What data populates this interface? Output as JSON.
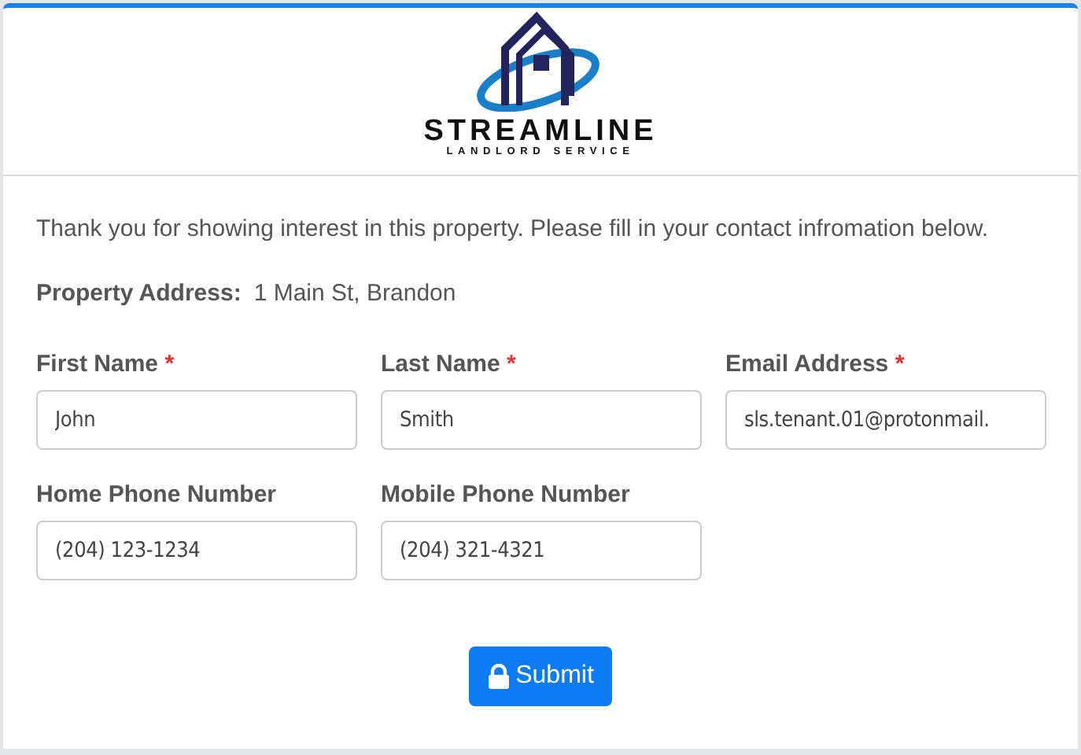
{
  "logo": {
    "name": "STREAMLINE",
    "tagline": "LANDLORD SERVICE"
  },
  "intro": "Thank you for showing interest in this property. Please fill in your contact infromation below.",
  "property_address": {
    "label": "Property Address:",
    "value": "1 Main St, Brandon"
  },
  "fields": [
    {
      "label": "First Name",
      "required": true,
      "value": "John"
    },
    {
      "label": "Last Name",
      "required": true,
      "value": "Smith"
    },
    {
      "label": "Email Address",
      "required": true,
      "value": "sls.tenant.01@protonmail."
    },
    {
      "label": "Home Phone Number",
      "required": false,
      "value": "(204) 123-1234"
    },
    {
      "label": "Mobile Phone Number",
      "required": false,
      "value": "(204) 321-4321"
    }
  ],
  "required_mark": "*",
  "submit": {
    "label": "Submit"
  }
}
